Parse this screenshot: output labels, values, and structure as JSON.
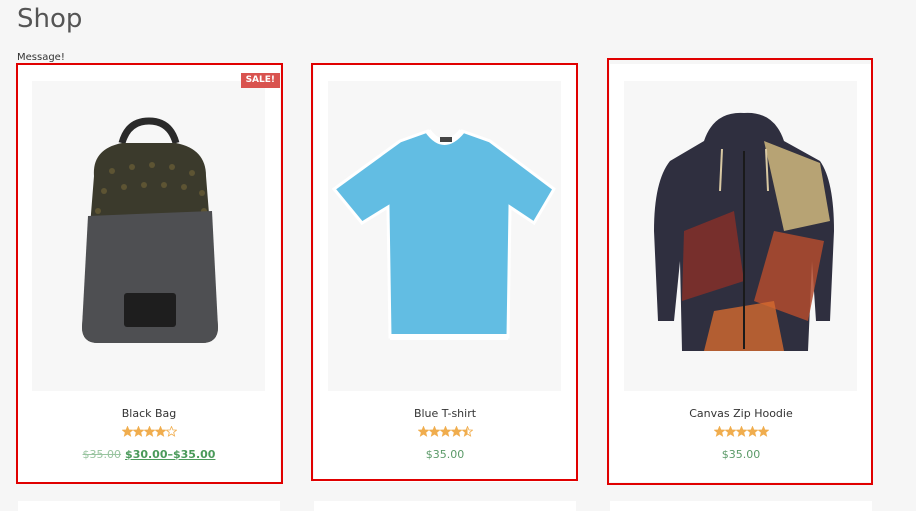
{
  "page": {
    "title": "Shop",
    "message": "Message!"
  },
  "products": [
    {
      "name": "Black Bag",
      "rating": 4,
      "rating_max": 5,
      "sale_badge": "SALE!",
      "old_price": "$35.00",
      "price": "$30.00–$35.00",
      "image": "backpack-image"
    },
    {
      "name": "Blue T-shirt",
      "rating": 4.5,
      "rating_max": 5,
      "price": "$35.00",
      "image": "tshirt-image"
    },
    {
      "name": "Canvas Zip Hoodie",
      "rating": 5,
      "rating_max": 5,
      "price": "$35.00",
      "image": "hoodie-image"
    }
  ],
  "colors": {
    "star": "#f0ad4e",
    "price": "#5b9a68",
    "sale": "#d9534f",
    "highlight": "#e00000"
  }
}
